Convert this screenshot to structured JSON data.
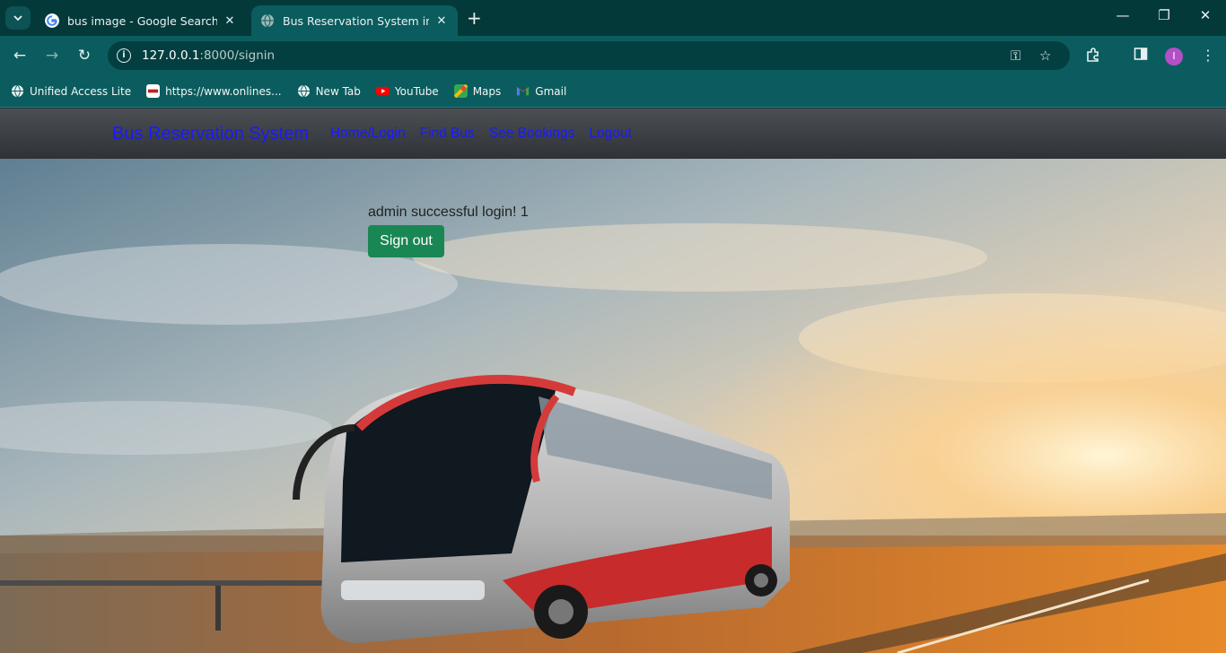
{
  "browser": {
    "tabs": [
      {
        "title": "bus image - Google Search",
        "icon": "google-icon",
        "active": false
      },
      {
        "title": "Bus Reservation System in Djan",
        "icon": "globe-icon",
        "active": true
      }
    ],
    "url_host": "127.0.0.1",
    "url_path": ":8000/signin",
    "profile_initial": "I",
    "bookmarks": [
      {
        "label": "Unified Access Lite",
        "icon": "globe-icon"
      },
      {
        "label": "https://www.onlines...",
        "icon": "nsdl-icon"
      },
      {
        "label": "New Tab",
        "icon": "globe-icon"
      },
      {
        "label": "YouTube",
        "icon": "youtube-icon"
      },
      {
        "label": "Maps",
        "icon": "maps-icon"
      },
      {
        "label": "Gmail",
        "icon": "gmail-icon"
      }
    ]
  },
  "navbar": {
    "brand": "Bus Reservation System",
    "links": [
      "Home/Login",
      "Find Bus",
      "See Bookings",
      "Logout"
    ]
  },
  "main": {
    "message": "admin successful login! 1",
    "signout_label": "Sign out"
  },
  "colors": {
    "chrome": "#0b5c5e",
    "link": "#1a1aff",
    "button": "#198754"
  }
}
